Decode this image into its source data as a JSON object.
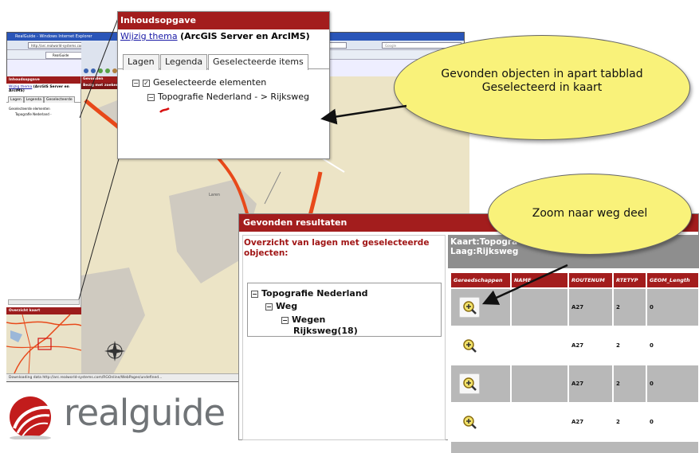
{
  "browser": {
    "title": "RealGuide - Windows Internet Explorer",
    "address": "http://arc.realworld-systems.com/RGOnline/",
    "search_placeholder": "Google",
    "tab_label": "RealGuide",
    "status": "Downloading data http://arc.realworld-systems.com/RGOnline/WebPages/undefined..."
  },
  "small_panel": {
    "header": "Inhoudsopgave",
    "theme_link": "Wijzig thema",
    "theme_text": "(ArcGIS Server en ArcIMS)",
    "tabs": [
      "Lagen",
      "Legenda",
      "Geselecteerde"
    ],
    "tree": [
      "Geselecteerde elementen",
      "Topografie Nederland -"
    ],
    "overview_header": "Overzicht kaart"
  },
  "map": {
    "header": "Gevonden resultaten",
    "subheader": "Bezig met zoeken",
    "place_label": "Laren"
  },
  "inhoud": {
    "header": "Inhoudsopgave",
    "theme_link": "Wijzig thema",
    "theme_text": "(ArcGIS Server en ArcIMS)",
    "tabs": [
      "Lagen",
      "Legenda",
      "Geselecteerde items"
    ],
    "tree_root": "Geselecteerde elementen",
    "tree_child": "Topografie Nederland - > Rijksweg"
  },
  "results": {
    "header": "Gevonden resultaten",
    "overview_title": "Overzicht van lagen met geselecteerde objecten:",
    "tree": {
      "root": "Topografie Nederland",
      "level1": "Weg",
      "level2": "Wegen",
      "leaf": "Rijksweg(18)"
    },
    "kaart_title": "Kaart:Topogra",
    "laag_title": "Laag:Rijksweg",
    "columns": [
      "Gereedschappen",
      "NAME",
      "ROUTENUM",
      "RTETYP",
      "GEOM_Length"
    ],
    "rows": [
      {
        "name": "",
        "routenum": "A27",
        "rtetyp": "2",
        "geom": "0"
      },
      {
        "name": "",
        "routenum": "A27",
        "rtetyp": "2",
        "geom": "0"
      },
      {
        "name": "",
        "routenum": "A27",
        "rtetyp": "2",
        "geom": "0"
      },
      {
        "name": "",
        "routenum": "A27",
        "rtetyp": "2",
        "geom": "0"
      }
    ]
  },
  "callouts": {
    "c1_line1": "Gevonden objecten in apart tabblad",
    "c1_line2": "Geselecteerd in kaart",
    "c2": "Zoom naar weg deel"
  },
  "logo": "realguide",
  "colors": {
    "maroon": "#a31d1d",
    "callout": "#f9f27a",
    "road": "#e8491a",
    "grid_grey": "#b8b8b8"
  }
}
